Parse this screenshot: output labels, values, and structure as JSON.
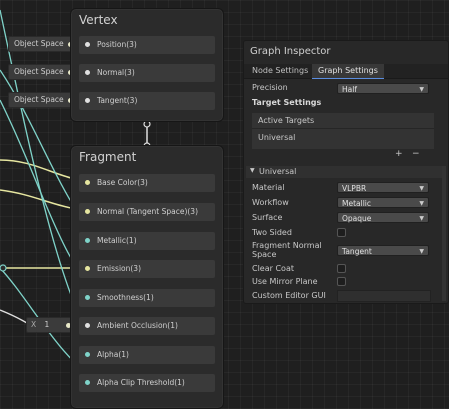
{
  "object_space_tags": [
    {
      "label": "Object Space"
    },
    {
      "label": "Object Space"
    },
    {
      "label": "Object Space"
    }
  ],
  "x_input": {
    "axis": "X",
    "value": "1"
  },
  "vertex": {
    "title": "Vertex",
    "slots": [
      "Position(3)",
      "Normal(3)",
      "Tangent(3)"
    ]
  },
  "fragment": {
    "title": "Fragment",
    "slots": [
      "Base Color(3)",
      "Normal (Tangent Space)(3)",
      "Metallic(1)",
      "Emission(3)",
      "Smoothness(1)",
      "Ambient Occlusion(1)",
      "Alpha(1)",
      "Alpha Clip Threshold(1)"
    ]
  },
  "inspector": {
    "title": "Graph Inspector",
    "tabs": [
      "Node Settings",
      "Graph Settings"
    ],
    "active_tab": "Graph Settings",
    "precision_label": "Precision",
    "precision_value": "Half",
    "target_settings_label": "Target Settings",
    "active_targets_label": "Active Targets",
    "active_targets": [
      "Universal"
    ],
    "add_label": "+",
    "remove_label": "−",
    "universal_header": "Universal",
    "fields": {
      "material_label": "Material",
      "material_value": "VLPBR",
      "workflow_label": "Workflow",
      "workflow_value": "Metallic",
      "surface_label": "Surface",
      "surface_value": "Opaque",
      "two_sided_label": "Two Sided",
      "fragment_normal_label_1": "Fragment Normal",
      "fragment_normal_label_2": "Space",
      "fragment_normal_value": "Tangent",
      "clear_coat_label": "Clear Coat",
      "mirror_plane_label": "Use Mirror Plane",
      "custom_gui_label": "Custom Editor GUI"
    }
  },
  "colors": {
    "wire_teal": "#7fd3c9",
    "wire_yellow": "#e6e6a0",
    "wire_white": "#e0e0e0",
    "accent_blue": "#5a8de0"
  }
}
